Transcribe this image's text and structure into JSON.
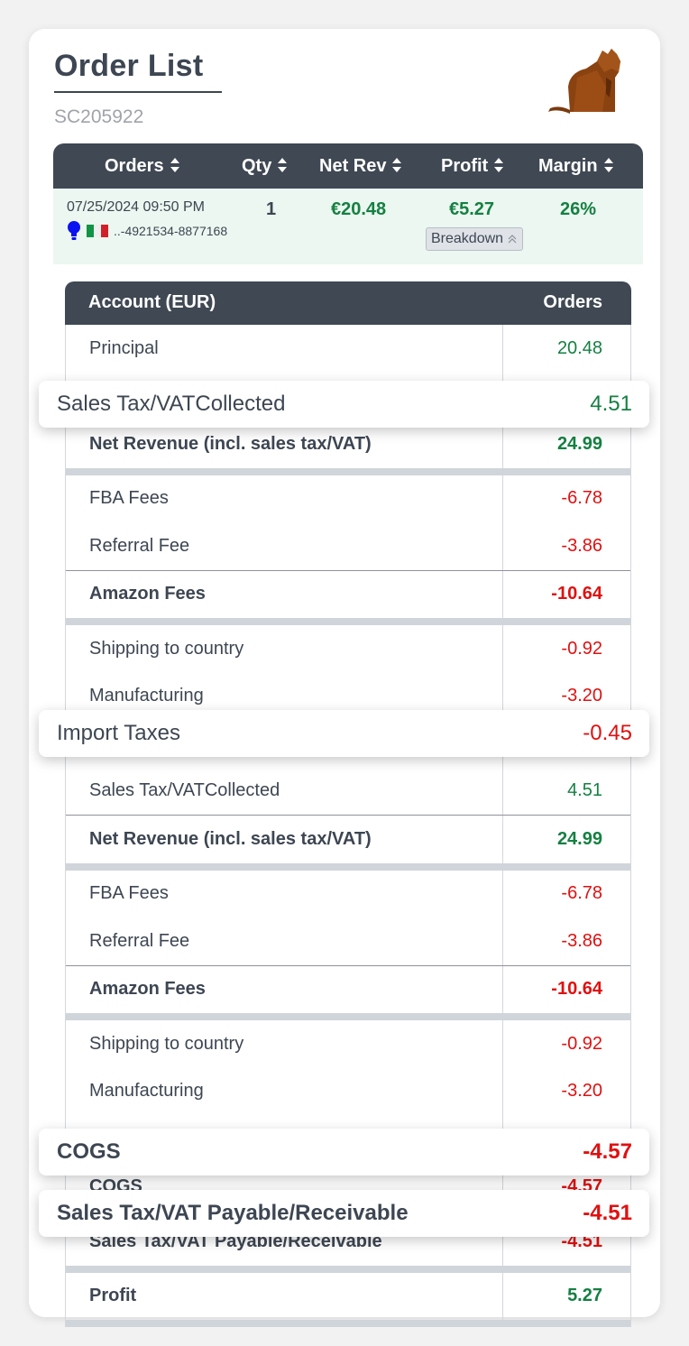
{
  "header": {
    "title": "Order List",
    "subtitle": "SC205922",
    "mascot": "origami-cat-image"
  },
  "orders_table": {
    "columns": [
      {
        "label": "Orders",
        "sortable": true
      },
      {
        "label": "Qty",
        "sortable": true
      },
      {
        "label": "Net Rev",
        "sortable": true
      },
      {
        "label": "Profit",
        "sortable": true
      },
      {
        "label": "Margin",
        "sortable": true
      }
    ],
    "row": {
      "datetime": "07/25/2024 09:50 PM",
      "icons": [
        "lightbulb-icon",
        "italy-flag-icon"
      ],
      "order_id": "..-4921534-8877168",
      "qty": "1",
      "net_rev": "€20.48",
      "profit": "€5.27",
      "margin": "26%",
      "breakdown_label": "Breakdown"
    }
  },
  "breakdown": {
    "header": {
      "account": "Account (EUR)",
      "orders": "Orders"
    },
    "rows": [
      {
        "label": "Principal",
        "value": "20.48",
        "tone": "pos"
      },
      {
        "label": "Sales Tax/VATCollected",
        "value": "4.51",
        "tone": "pos"
      },
      {
        "label": "Net Revenue (incl. sales tax/VAT)",
        "value": "24.99",
        "tone": "pos",
        "bold": true
      },
      {
        "label": "FBA Fees",
        "value": "-6.78",
        "tone": "neg"
      },
      {
        "label": "Referral Fee",
        "value": "-3.86",
        "tone": "neg"
      },
      {
        "label": "Amazon Fees",
        "value": "-10.64",
        "tone": "neg",
        "bold": true
      },
      {
        "label": "Shipping to country",
        "value": "-0.92",
        "tone": "neg"
      },
      {
        "label": "Manufacturing",
        "value": "-3.20",
        "tone": "neg"
      },
      {
        "label": "Import Taxes",
        "value": "-0.45",
        "tone": "neg"
      },
      {
        "label": "Sales Tax/VATCollected",
        "value": "4.51",
        "tone": "pos"
      },
      {
        "label": "Net Revenue (incl. sales tax/VAT)",
        "value": "24.99",
        "tone": "pos",
        "bold": true
      },
      {
        "label": "FBA Fees",
        "value": "-6.78",
        "tone": "neg"
      },
      {
        "label": "Referral Fee",
        "value": "-3.86",
        "tone": "neg"
      },
      {
        "label": "Amazon Fees",
        "value": "-10.64",
        "tone": "neg",
        "bold": true
      },
      {
        "label": "Shipping to country",
        "value": "-0.92",
        "tone": "neg"
      },
      {
        "label": "Manufacturing",
        "value": "-3.20",
        "tone": "neg"
      },
      {
        "label": "Import Taxes",
        "value": "-0.45",
        "tone": "neg"
      },
      {
        "label": "COGS",
        "value": "-4.57",
        "tone": "neg",
        "bold": true
      },
      {
        "label": "Sales Tax/VAT Payable/Receivable",
        "value": "-4.51",
        "tone": "neg",
        "bold": true
      },
      {
        "label": "Profit",
        "value": "5.27",
        "tone": "pos",
        "bold": true
      }
    ],
    "highlighted": [
      {
        "label": "Sales Tax/VATCollected",
        "value": "4.51",
        "tone": "pos"
      },
      {
        "label": "Import Taxes",
        "value": "-0.45",
        "tone": "neg"
      },
      {
        "label": "COGS",
        "value": "-4.57",
        "tone": "neg",
        "bold": true
      },
      {
        "label": "Sales Tax/VAT Payable/Receivable",
        "value": "-4.51",
        "tone": "neg",
        "bold": true
      }
    ]
  },
  "colors": {
    "header_bg": "#3f4853",
    "positive": "#158042",
    "negative": "#e01010",
    "row_highlight": "#ebf7f0"
  }
}
